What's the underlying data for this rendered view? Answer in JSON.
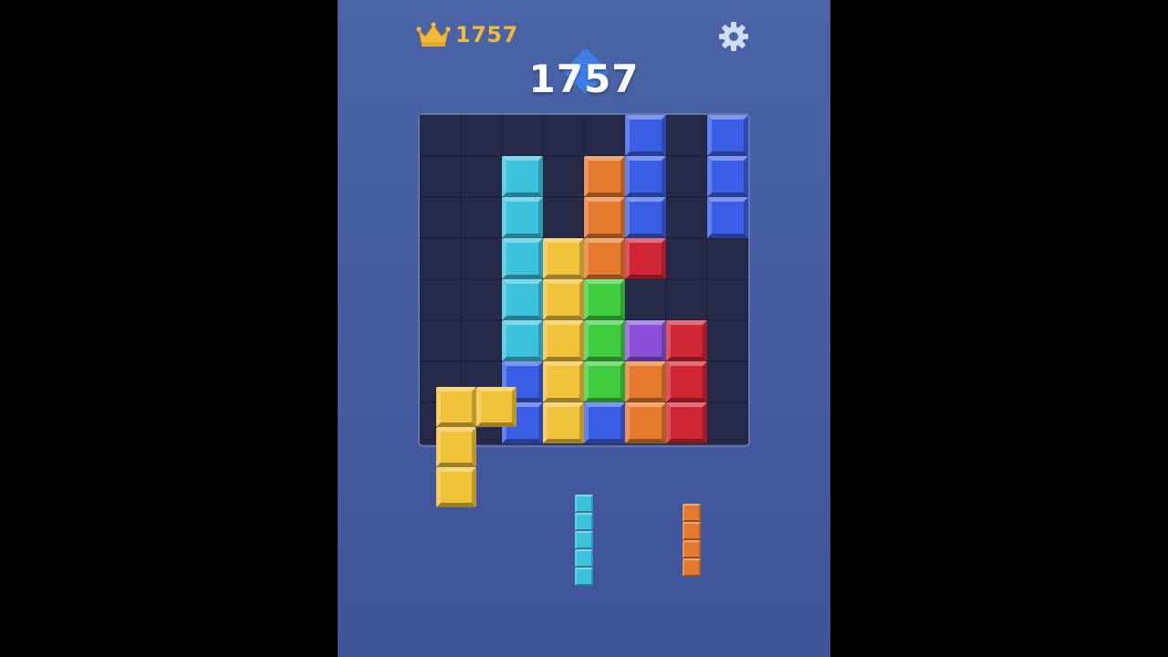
{
  "best_score": "1757",
  "current_score": "1757",
  "colors": {
    "cyan": "#3cc2dc",
    "orange": "#e57a2e",
    "blue": "#3a5ee6",
    "yellow": "#efc23a",
    "green": "#3fcc3f",
    "purple": "#8c4fd8",
    "red": "#cf2535",
    "empty": "#242a48",
    "accent": "#f2b93b"
  },
  "board": {
    "rows": 8,
    "cols": 8,
    "grid": [
      [
        null,
        null,
        null,
        null,
        null,
        "blue",
        null,
        "blue"
      ],
      [
        null,
        null,
        "cyan",
        null,
        "orange",
        "blue",
        null,
        "blue"
      ],
      [
        null,
        null,
        "cyan",
        null,
        "orange",
        "blue",
        null,
        "blue"
      ],
      [
        null,
        null,
        "cyan",
        "yellow",
        "orange",
        "red",
        null,
        null
      ],
      [
        null,
        null,
        "cyan",
        "yellow",
        "green",
        null,
        null,
        null
      ],
      [
        null,
        null,
        "cyan",
        "yellow",
        "green",
        "purple",
        "red",
        null
      ],
      [
        null,
        null,
        "blue",
        "yellow",
        "green",
        "orange",
        "red",
        null
      ],
      [
        null,
        null,
        "blue",
        "yellow",
        "blue",
        "orange",
        "red",
        null
      ]
    ]
  },
  "dragged_piece": {
    "color": "yellow",
    "cells": [
      [
        0,
        0
      ],
      [
        0,
        1
      ],
      [
        1,
        0
      ],
      [
        2,
        0
      ]
    ]
  },
  "tray": [
    {
      "color": "cyan",
      "cells": [
        [
          0,
          0
        ],
        [
          1,
          0
        ],
        [
          2,
          0
        ],
        [
          3,
          0
        ],
        [
          4,
          0
        ]
      ]
    },
    {
      "color": "orange",
      "cells": [
        [
          0,
          0
        ],
        [
          1,
          0
        ],
        [
          2,
          0
        ],
        [
          3,
          0
        ]
      ]
    }
  ],
  "icons": {
    "best": "crown-icon",
    "settings": "gear-icon"
  }
}
